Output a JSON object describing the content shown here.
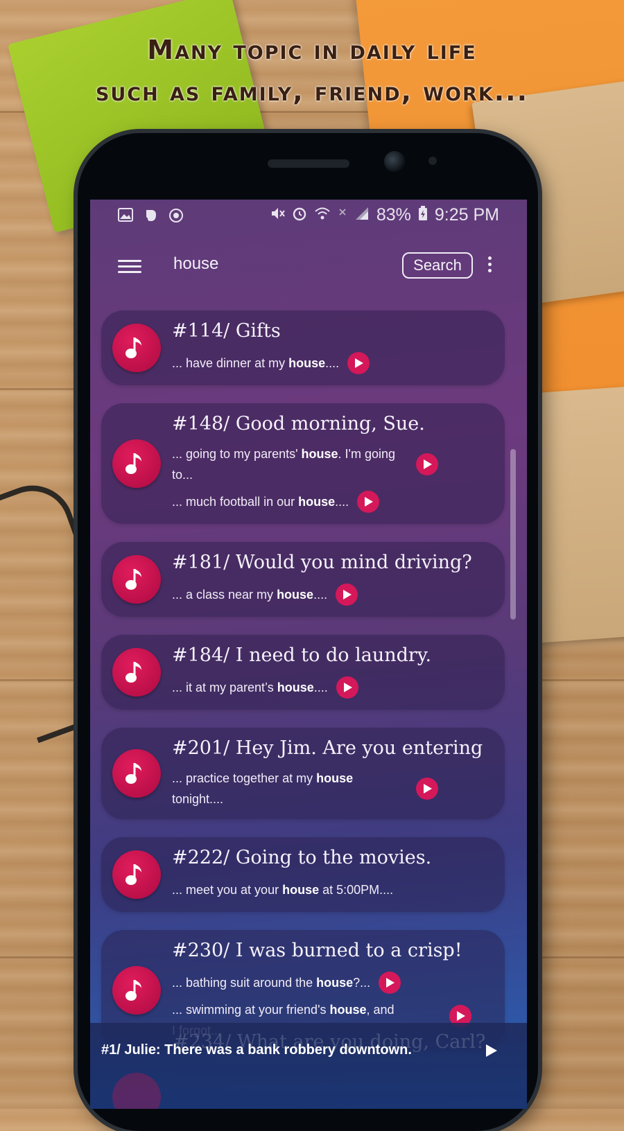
{
  "headline": {
    "line1": "Many topic in daily life",
    "line2": "such as family, friend, work..."
  },
  "statusbar": {
    "left_icons": [
      "image-icon",
      "evernote-icon",
      "cast-icon"
    ],
    "right_icons": [
      "mute-icon",
      "alarm-icon",
      "wifi-icon",
      "nfc-icon",
      "signal-icon"
    ],
    "battery": "83%",
    "time": "9:25 PM"
  },
  "appbar": {
    "search_value": "house",
    "search_button": "Search"
  },
  "results": [
    {
      "title": "#114/ Gifts",
      "snippets": [
        {
          "pre": "... have dinner at my ",
          "bold": "house",
          "post": "...."
        }
      ]
    },
    {
      "title": "#148/ Good morning, Sue.",
      "snippets": [
        {
          "pre": "... going to my parents' ",
          "bold": "house",
          "post": ". I'm going to..."
        },
        {
          "pre": "... much football in our ",
          "bold": "house",
          "post": "...."
        }
      ]
    },
    {
      "title": "#181/ Would you mind driving?",
      "snippets": [
        {
          "pre": "... a class near my ",
          "bold": "house",
          "post": "...."
        }
      ]
    },
    {
      "title": "#184/ I need to do laundry.",
      "snippets": [
        {
          "pre": "... it at my parent’s ",
          "bold": "house",
          "post": "...."
        }
      ]
    },
    {
      "title": "#201/ Hey Jim. Are you entering",
      "snippets": [
        {
          "pre": "... practice together at my ",
          "bold": "house",
          "post": " tonight...."
        }
      ]
    },
    {
      "title": "#222/ Going to the movies.",
      "snippets": [
        {
          "pre": "... meet you at your ",
          "bold": "house",
          "post": " at 5:00PM...."
        }
      ]
    },
    {
      "title": "#230/ I was burned to a crisp!",
      "snippets": [
        {
          "pre": "... bathing suit around the ",
          "bold": "house",
          "post": "?..."
        },
        {
          "pre": "... swimming at your friend's ",
          "bold": "house",
          "post": ", and I forgot..."
        }
      ]
    }
  ],
  "player": {
    "background_title": "#234/ What are you doing, Carl?",
    "now_playing": "#1/ Julie: There was a bank robbery downtown."
  },
  "colors": {
    "accent": "#d4185a",
    "disc": "#c8124f",
    "gradient_top": "#5e3b78",
    "gradient_bottom": "#2d6fc0"
  }
}
